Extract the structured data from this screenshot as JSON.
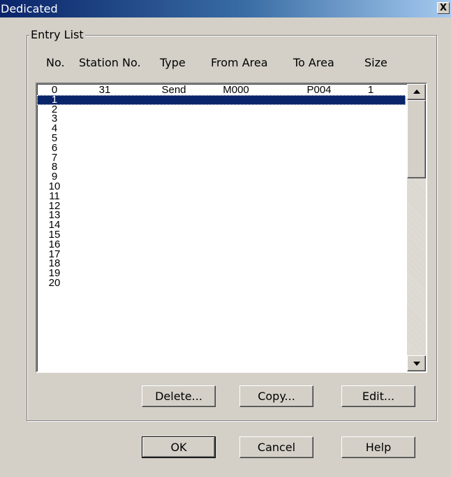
{
  "window": {
    "title": "Dedicated",
    "close_label": "X"
  },
  "group": {
    "legend": "Entry List"
  },
  "columns": {
    "no": "No.",
    "station": "Station No.",
    "type": "Type",
    "from": "From Area",
    "to": "To Area",
    "size": "Size"
  },
  "rows": [
    {
      "no": "0",
      "station": "31",
      "type": "Send",
      "from": "M000",
      "to": "P004",
      "size": "1"
    },
    {
      "no": "1",
      "station": "",
      "type": "",
      "from": "",
      "to": "",
      "size": ""
    },
    {
      "no": "2",
      "station": "",
      "type": "",
      "from": "",
      "to": "",
      "size": ""
    },
    {
      "no": "3",
      "station": "",
      "type": "",
      "from": "",
      "to": "",
      "size": ""
    },
    {
      "no": "4",
      "station": "",
      "type": "",
      "from": "",
      "to": "",
      "size": ""
    },
    {
      "no": "5",
      "station": "",
      "type": "",
      "from": "",
      "to": "",
      "size": ""
    },
    {
      "no": "6",
      "station": "",
      "type": "",
      "from": "",
      "to": "",
      "size": ""
    },
    {
      "no": "7",
      "station": "",
      "type": "",
      "from": "",
      "to": "",
      "size": ""
    },
    {
      "no": "8",
      "station": "",
      "type": "",
      "from": "",
      "to": "",
      "size": ""
    },
    {
      "no": "9",
      "station": "",
      "type": "",
      "from": "",
      "to": "",
      "size": ""
    },
    {
      "no": "10",
      "station": "",
      "type": "",
      "from": "",
      "to": "",
      "size": ""
    },
    {
      "no": "11",
      "station": "",
      "type": "",
      "from": "",
      "to": "",
      "size": ""
    },
    {
      "no": "12",
      "station": "",
      "type": "",
      "from": "",
      "to": "",
      "size": ""
    },
    {
      "no": "13",
      "station": "",
      "type": "",
      "from": "",
      "to": "",
      "size": ""
    },
    {
      "no": "14",
      "station": "",
      "type": "",
      "from": "",
      "to": "",
      "size": ""
    },
    {
      "no": "15",
      "station": "",
      "type": "",
      "from": "",
      "to": "",
      "size": ""
    },
    {
      "no": "16",
      "station": "",
      "type": "",
      "from": "",
      "to": "",
      "size": ""
    },
    {
      "no": "17",
      "station": "",
      "type": "",
      "from": "",
      "to": "",
      "size": ""
    },
    {
      "no": "18",
      "station": "",
      "type": "",
      "from": "",
      "to": "",
      "size": ""
    },
    {
      "no": "19",
      "station": "",
      "type": "",
      "from": "",
      "to": "",
      "size": ""
    },
    {
      "no": "20",
      "station": "",
      "type": "",
      "from": "",
      "to": "",
      "size": ""
    }
  ],
  "selected_row": "1",
  "list_buttons": {
    "delete": "Delete...",
    "copy": "Copy...",
    "edit": "Edit..."
  },
  "dialog_buttons": {
    "ok": "OK",
    "cancel": "Cancel",
    "help": "Help"
  },
  "icons": {
    "close": "close-icon",
    "scroll_up": "scroll-up-arrow-icon",
    "scroll_down": "scroll-down-arrow-icon"
  },
  "colors": {
    "title_bar": "#0a246a",
    "selection": "#0a246a",
    "face": "#d4d0c8"
  }
}
